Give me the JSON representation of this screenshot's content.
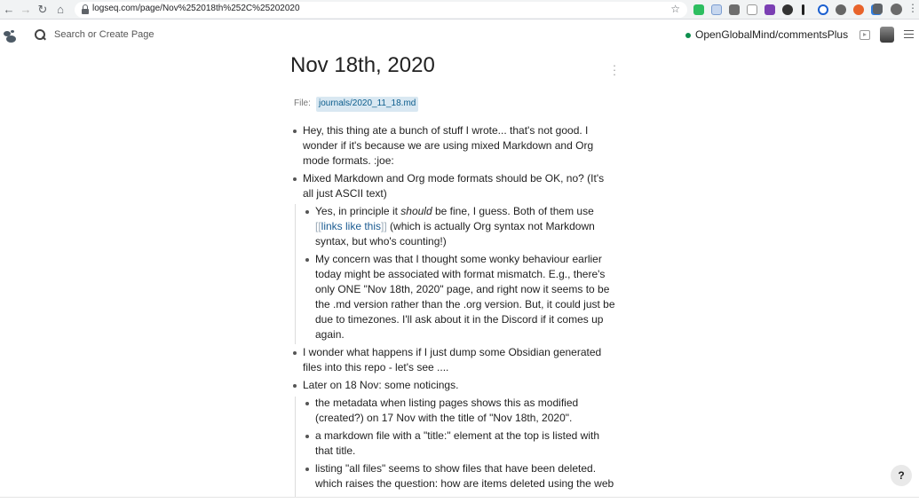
{
  "browser": {
    "url": "logseq.com/page/Nov%252018th%252C%25202020"
  },
  "header": {
    "search_placeholder": "Search or Create Page",
    "repo": "OpenGlobalMind/commentsPlus"
  },
  "page": {
    "title": "Nov 18th, 2020",
    "file_label": "File:",
    "file_path": "journals/2020_11_18.md"
  },
  "blocks": {
    "b1": {
      "lines": [
        "Hey, this thing ate a bunch of stuff I wrote... that's not good.  I",
        "wonder if it's because we are using mixed Markdown and Org",
        "mode formats. :joe:"
      ]
    },
    "b2": {
      "lines": [
        "Mixed Markdown and Org mode formats should be OK, no? (It's",
        "all just ASCII text)"
      ]
    },
    "b2a": {
      "l1_pre": "Yes, in principle it ",
      "l1_em": "should",
      "l1_post": " be fine, I guess. Both of them use",
      "open_brackets": "[[",
      "link_text": "links like this",
      "close_brackets": "]]",
      "l2_post": " (which is actually Org syntax not Markdown",
      "l3": "syntax, but who's counting!)"
    },
    "b2b": {
      "lines": [
        "My concern was that I thought some wonky behaviour earlier",
        "today might be associated with format mismatch. E.g., there's",
        "only ONE \"Nov 18th, 2020\" page, and right now it seems to be",
        "the .md version rather than the .org version. But, it could just be",
        "due to timezones. I'll ask about it in the Discord if it comes up",
        "again."
      ]
    },
    "b3": {
      "lines": [
        "I wonder what happens if I just dump some Obsidian generated",
        "files into this repo - let's see ...."
      ]
    },
    "b4": {
      "lines": [
        "Later on 18 Nov: some noticings."
      ]
    },
    "b4a": {
      "lines": [
        "the metadata when listing pages shows this as modified",
        "(created?) on 17 Nov with the title of \"Nov 18th, 2020\"."
      ]
    },
    "b4b": {
      "lines": [
        "a markdown file with a \"title:\" element at the top is listed with",
        "that title."
      ]
    },
    "b4c": {
      "lines": [
        "listing \"all files\" seems to show files that have been deleted.",
        "which raises the question: how are items deleted using the web"
      ]
    }
  },
  "help": {
    "label": "?"
  },
  "colors": {
    "accent_link": "#1a5b91",
    "file_chip_bg": "#d9e8f2",
    "repo_status": "#0e8f4d"
  }
}
